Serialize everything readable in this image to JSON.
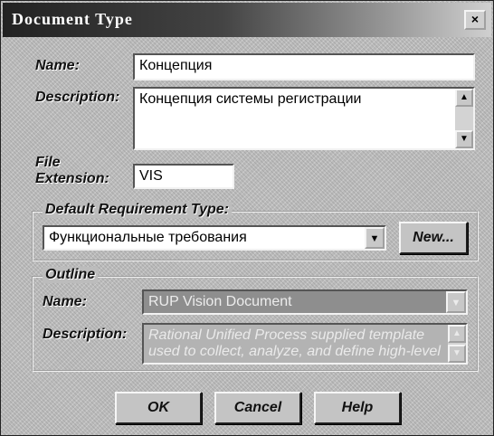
{
  "window": {
    "title": "Document Type",
    "close_label": "×"
  },
  "name": {
    "label": "Name:",
    "value": "Концепция"
  },
  "description": {
    "label": "Description:",
    "value": "Концепция системы регистрации"
  },
  "file_extension": {
    "label_line1": "File",
    "label_line2": "Extension:",
    "value": "VIS"
  },
  "default_requirement_type": {
    "group_label": "Default Requirement Type:",
    "selected": "Функциональные требования",
    "new_button": "New..."
  },
  "outline": {
    "group_label": "Outline",
    "name_label": "Name:",
    "name_value": "RUP Vision Document",
    "description_label": "Description:",
    "description_value": "Rational Unified Process supplied template used to collect, analyze, and define high-level"
  },
  "buttons": {
    "ok": "OK",
    "cancel": "Cancel",
    "help": "Help"
  },
  "icons": {
    "scroll_up": "▲",
    "scroll_down": "▼",
    "dropdown": "▼"
  }
}
